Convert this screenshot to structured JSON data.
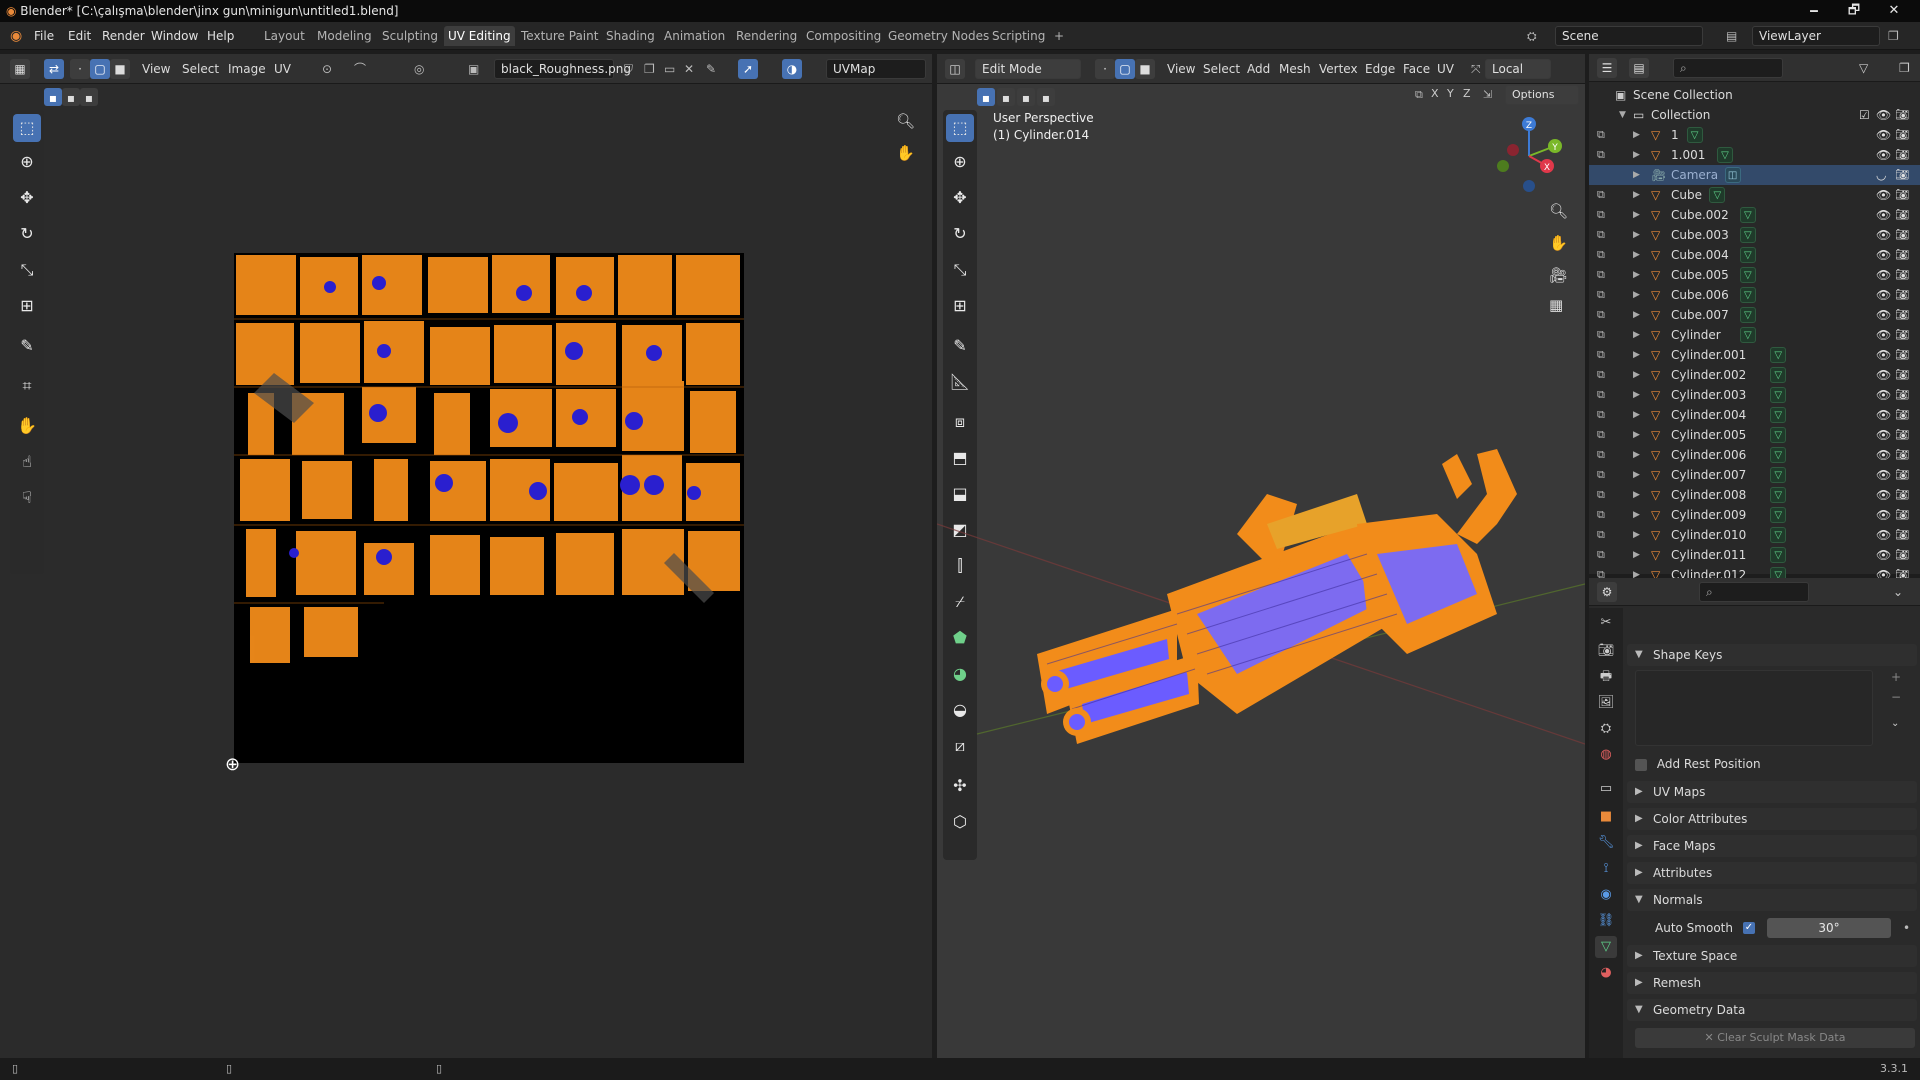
{
  "titlebar": {
    "title": "Blender* [C:\\çalışma\\blender\\jinx gun\\minigun\\untitled1.blend]",
    "minimize": "🗕",
    "maximize": "🗗",
    "close": "✕"
  },
  "menu": {
    "items": [
      "File",
      "Edit",
      "Render",
      "Window",
      "Help"
    ]
  },
  "workspaces": {
    "tabs": [
      "Layout",
      "Modeling",
      "Sculpting",
      "UV Editing",
      "Texture Paint",
      "Shading",
      "Animation",
      "Rendering",
      "Compositing",
      "Geometry Nodes",
      "Scripting"
    ],
    "active": "UV Editing",
    "add": "+"
  },
  "scene": {
    "scene_name": "Scene",
    "view_layer": "ViewLayer"
  },
  "uv_editor": {
    "menus": [
      "View",
      "Select",
      "Image",
      "UV"
    ],
    "image_name": "black_Roughness.png",
    "uvmap": "UVMap"
  },
  "viewport": {
    "mode": "Edit Mode",
    "menus": [
      "View",
      "Select",
      "Add",
      "Mesh",
      "Vertex",
      "Edge",
      "Face",
      "UV"
    ],
    "transform_orientation": "Local",
    "options": "Options",
    "axes_toggle": [
      "X",
      "Y",
      "Z"
    ],
    "overlay_text_1": "User Perspective",
    "overlay_text_2": "(1) Cylinder.014",
    "gizmo_labels": [
      "Z",
      "Y",
      "X"
    ]
  },
  "outliner": {
    "scene_collection": "Scene Collection",
    "collection": "Collection",
    "objects": [
      "1",
      "1.001",
      "Camera",
      "Cube",
      "Cube.002",
      "Cube.003",
      "Cube.004",
      "Cube.005",
      "Cube.006",
      "Cube.007",
      "Cylinder",
      "Cylinder.001",
      "Cylinder.002",
      "Cylinder.003",
      "Cylinder.004",
      "Cylinder.005",
      "Cylinder.006",
      "Cylinder.007",
      "Cylinder.008",
      "Cylinder.009",
      "Cylinder.010",
      "Cylinder.011",
      "Cylinder.012"
    ]
  },
  "properties": {
    "shape_keys": "Shape Keys",
    "add_rest_position": "Add Rest Position",
    "uv_maps": "UV Maps",
    "color_attributes": "Color Attributes",
    "face_maps": "Face Maps",
    "attributes": "Attributes",
    "normals": "Normals",
    "auto_smooth": "Auto Smooth",
    "auto_smooth_angle": "30°",
    "texture_space": "Texture Space",
    "remesh": "Remesh",
    "geometry_data": "Geometry Data",
    "clear_sculpt_mask": "Clear Sculpt Mask Data"
  },
  "statusbar": {
    "version": "3.3.1"
  },
  "colors": {
    "accent": "#4772b3",
    "uv_orange": "#f28c1a",
    "uv_blue": "#2a1fcf",
    "mesh_green": "#5fd48a"
  }
}
